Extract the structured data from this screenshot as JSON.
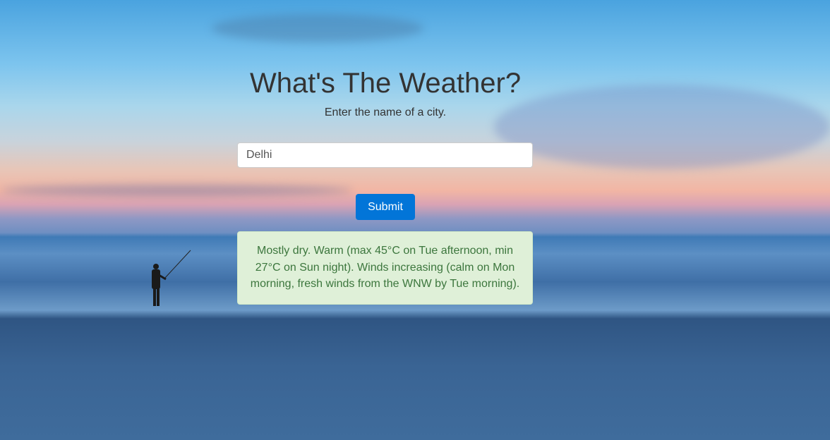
{
  "header": {
    "title": "What's The Weather?",
    "subtitle": "Enter the name of a city."
  },
  "form": {
    "city_value": "Delhi",
    "submit_label": "Submit"
  },
  "result": {
    "text": "Mostly dry. Warm (max 45°C on Tue afternoon, min 27°C on Sun night). Winds increasing (calm on Mon morning, fresh winds from the WNW by Tue morning)."
  },
  "colors": {
    "button": "#0275d8",
    "alert_bg": "#dff0d8",
    "alert_text": "#3c763d"
  }
}
